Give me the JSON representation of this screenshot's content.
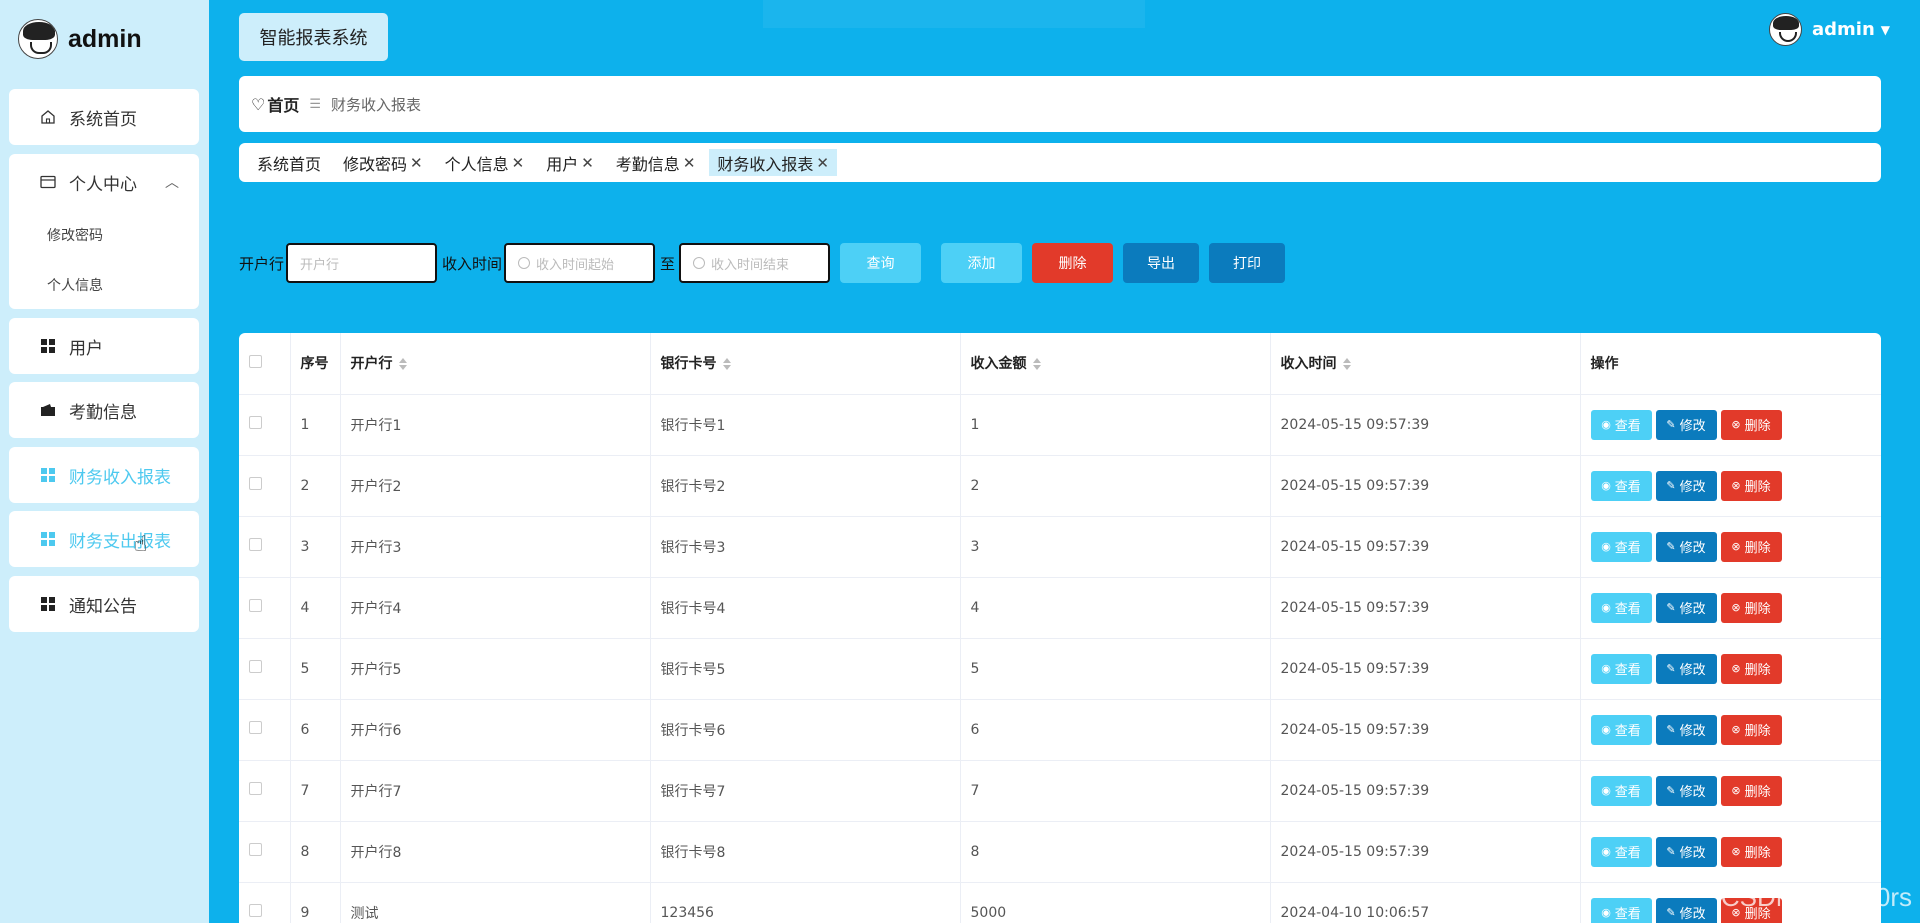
{
  "sidebar": {
    "title": "admin",
    "items": [
      {
        "label": "系统首页"
      },
      {
        "label": "个人中心",
        "sub": [
          "修改密码",
          "个人信息"
        ]
      },
      {
        "label": "用户"
      },
      {
        "label": "考勤信息"
      },
      {
        "label": "财务收入报表"
      },
      {
        "label": "财务支出报表"
      },
      {
        "label": "通知公告"
      }
    ]
  },
  "header": {
    "system_title": "智能报表系统",
    "user_name": "admin"
  },
  "breadcrumb": {
    "home": "首页",
    "current": "财务收入报表"
  },
  "tabs": [
    "系统首页",
    "修改密码",
    "个人信息",
    "用户",
    "考勤信息",
    "财务收入报表"
  ],
  "search": {
    "bank_label": "开户行",
    "bank_placeholder": "开户行",
    "time_label": "收入时间",
    "time_start_placeholder": "收入时间起始",
    "to_label": "至",
    "time_end_placeholder": "收入时间结束",
    "query_button": "查询",
    "add_button": "添加",
    "delete_button": "删除",
    "export_button": "导出",
    "print_button": "打印"
  },
  "table": {
    "columns": [
      "序号",
      "开户行",
      "银行卡号",
      "收入金额",
      "收入时间",
      "操作"
    ],
    "rows": [
      [
        "1",
        "开户行1",
        "银行卡号1",
        "1",
        "2024-05-15 09:57:39"
      ],
      [
        "2",
        "开户行2",
        "银行卡号2",
        "2",
        "2024-05-15 09:57:39"
      ],
      [
        "3",
        "开户行3",
        "银行卡号3",
        "3",
        "2024-05-15 09:57:39"
      ],
      [
        "4",
        "开户行4",
        "银行卡号4",
        "4",
        "2024-05-15 09:57:39"
      ],
      [
        "5",
        "开户行5",
        "银行卡号5",
        "5",
        "2024-05-15 09:57:39"
      ],
      [
        "6",
        "开户行6",
        "银行卡号6",
        "6",
        "2024-05-15 09:57:39"
      ],
      [
        "7",
        "开户行7",
        "银行卡号7",
        "7",
        "2024-05-15 09:57:39"
      ],
      [
        "8",
        "开户行8",
        "银行卡号8",
        "8",
        "2024-05-15 09:57:39"
      ],
      [
        "9",
        "测试",
        "123456",
        "5000",
        "2024-04-10 10:06:57"
      ]
    ],
    "row_actions": {
      "view": "查看",
      "edit": "修改",
      "delete": "删除"
    }
  },
  "watermark": "CSDN @Deh0rs",
  "colors": {
    "background": "#0db1ec",
    "sidebar": "#cdeefb",
    "accent": "#4dc9ef",
    "danger": "#e23a2a",
    "primary_dark": "#0b7bbd"
  }
}
